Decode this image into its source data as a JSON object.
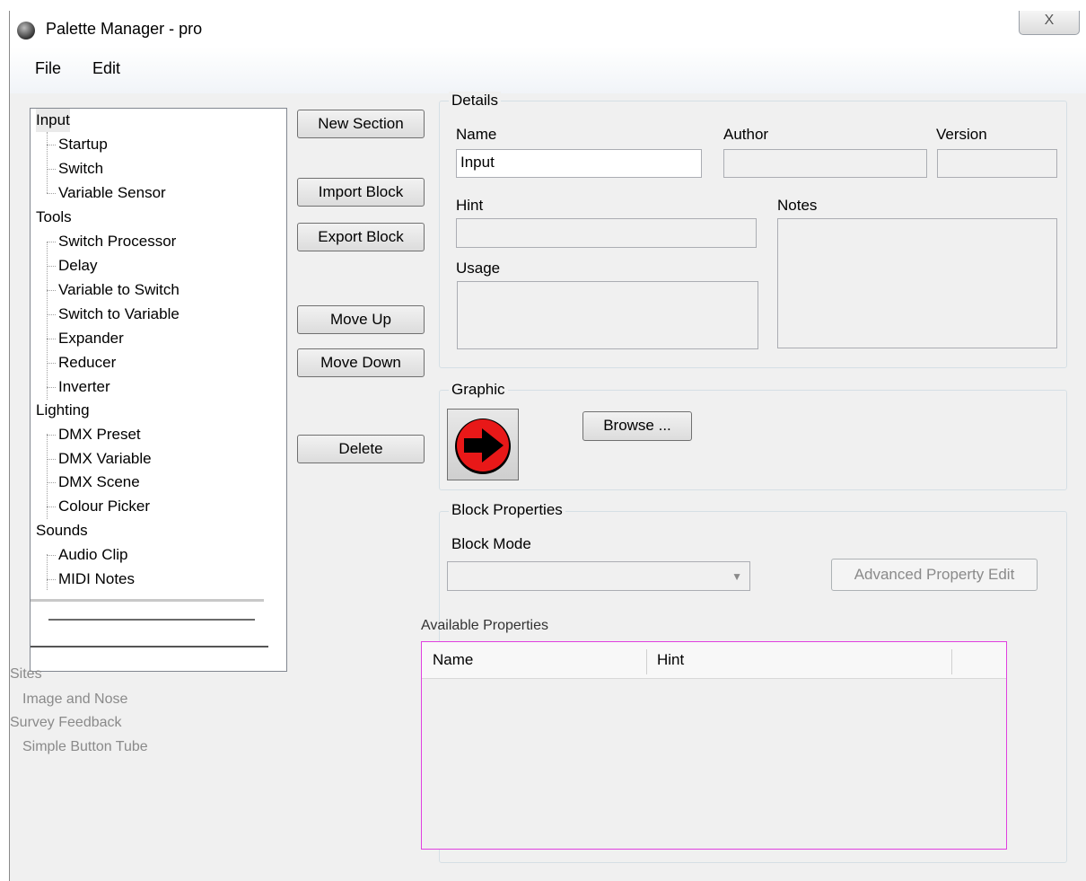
{
  "window": {
    "title": "Palette Manager - pro",
    "close_label": "X"
  },
  "menu": {
    "file": "File",
    "edit": "Edit"
  },
  "tree": {
    "sections": [
      {
        "label": "Input",
        "items": [
          "Startup",
          "Switch",
          "Variable Sensor"
        ]
      },
      {
        "label": "Tools",
        "items": [
          "Switch Processor",
          "Delay",
          "Variable to Switch",
          "Switch to Variable",
          "Expander",
          "Reducer",
          "Inverter"
        ]
      },
      {
        "label": "Lighting",
        "items": [
          "DMX Preset",
          "DMX Variable",
          "DMX Scene",
          "Colour Picker"
        ]
      },
      {
        "label": "Sounds",
        "items": [
          "Audio Clip",
          "MIDI Notes"
        ]
      }
    ],
    "glitched_lines": [
      "Sites",
      "Image and Nose",
      "Survey Feedback",
      "Simple Button Tube"
    ]
  },
  "buttons": {
    "new_section": "New Section",
    "import_block": "Import Block",
    "export_block": "Export Block",
    "move_up": "Move Up",
    "move_down": "Move Down",
    "delete": "Delete",
    "browse": "Browse ...",
    "advanced_edit": "Advanced Property Edit"
  },
  "details": {
    "group_label": "Details",
    "name_label": "Name",
    "name_value": "Input",
    "author_label": "Author",
    "version_label": "Version",
    "hint_label": "Hint",
    "notes_label": "Notes",
    "usage_label": "Usage"
  },
  "graphic": {
    "group_label": "Graphic",
    "icon": "red-arrow-right-icon"
  },
  "block_properties": {
    "group_label": "Block Properties",
    "block_mode_label": "Block Mode",
    "available_label": "Available Properties",
    "columns": [
      "Name",
      "Hint"
    ]
  }
}
